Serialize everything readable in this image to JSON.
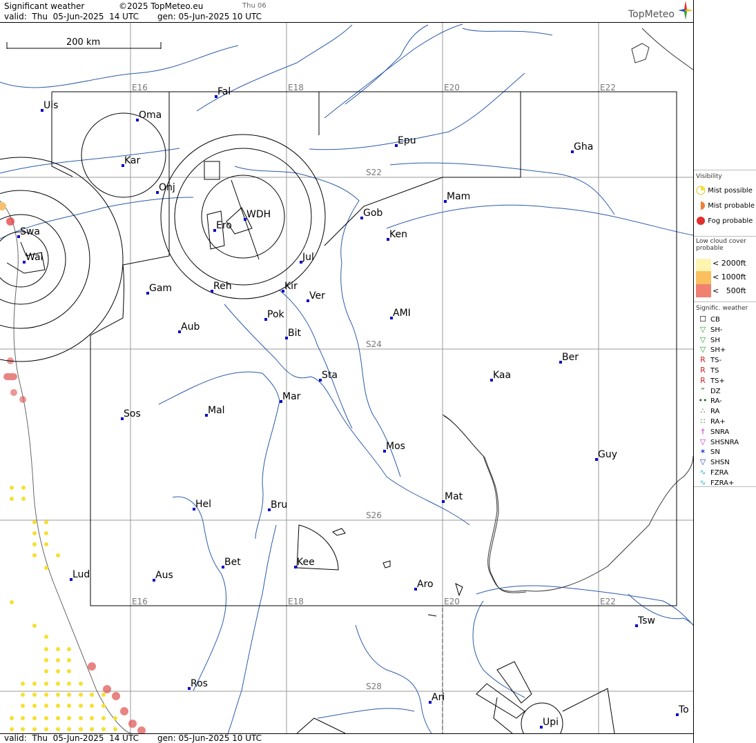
{
  "header": {
    "product": "Significant weather",
    "copyright": "©2025 TopMeteo.eu",
    "day_tag": "Thu 06",
    "valid": "valid:  Thu  05-Jun-2025  14 UTC",
    "generated": "gen: 05-Jun-2025 10 UTC",
    "brand": "TopMeteo"
  },
  "footer": {
    "valid": "valid:  Thu  05-Jun-2025  14 UTC",
    "generated": "gen: 05-Jun-2025 10 UTC"
  },
  "scale_bar": {
    "label": "200 km"
  },
  "grid_labels": {
    "lon_top": [
      "E16",
      "E18",
      "E20",
      "E22"
    ],
    "lon_bottom": [
      "E16",
      "E18",
      "E20",
      "E22"
    ],
    "lat": [
      "S22",
      "S24",
      "S26",
      "S28"
    ]
  },
  "places": [
    {
      "name": "Uis"
    },
    {
      "name": "Fal"
    },
    {
      "name": "Oma"
    },
    {
      "name": "Kar"
    },
    {
      "name": "Epu"
    },
    {
      "name": "Gha"
    },
    {
      "name": "Onj"
    },
    {
      "name": "Mam"
    },
    {
      "name": "Swa"
    },
    {
      "name": "WDH"
    },
    {
      "name": "Gob"
    },
    {
      "name": "Ero"
    },
    {
      "name": "Ken"
    },
    {
      "name": "Wal"
    },
    {
      "name": "Jul"
    },
    {
      "name": "Gam"
    },
    {
      "name": "Reh"
    },
    {
      "name": "Kir"
    },
    {
      "name": "Ver"
    },
    {
      "name": "Pok"
    },
    {
      "name": "AMI"
    },
    {
      "name": "Aub"
    },
    {
      "name": "Bit"
    },
    {
      "name": "Ber"
    },
    {
      "name": "Sta"
    },
    {
      "name": "Kaa"
    },
    {
      "name": "Mar"
    },
    {
      "name": "Sos"
    },
    {
      "name": "Mal"
    },
    {
      "name": "Mos"
    },
    {
      "name": "Guy"
    },
    {
      "name": "Mat"
    },
    {
      "name": "Hel"
    },
    {
      "name": "Bru"
    },
    {
      "name": "Bet"
    },
    {
      "name": "Kee"
    },
    {
      "name": "Lud"
    },
    {
      "name": "Aus"
    },
    {
      "name": "Aro"
    },
    {
      "name": "Tsw"
    },
    {
      "name": "Ros"
    },
    {
      "name": "Ari"
    },
    {
      "name": "To"
    },
    {
      "name": "Upi"
    }
  ],
  "legend": {
    "visibility": {
      "title": "Visibility",
      "items": [
        "Mist possible",
        "Mist probable",
        "Fog probable"
      ],
      "colors": [
        "#f5e030",
        "#f08030",
        "#e03030"
      ]
    },
    "low_cloud": {
      "title": "Low cloud cover probable",
      "items": [
        "< 2000ft",
        "< 1000ft",
        "<   500ft"
      ],
      "colors": [
        "#fff3b0",
        "#fbbf60",
        "#f08070"
      ]
    },
    "sigwx": {
      "title": "Signific. weather",
      "items": [
        {
          "label": "CB",
          "icon": "cb-icon",
          "color": "#000"
        },
        {
          "label": "SH-",
          "icon": "shower-light-icon",
          "color": "#2a9a2a"
        },
        {
          "label": "SH",
          "icon": "shower-icon",
          "color": "#2a9a2a"
        },
        {
          "label": "SH+",
          "icon": "shower-heavy-icon",
          "color": "#2a9a2a"
        },
        {
          "label": "TS-",
          "icon": "thunderstorm-light-icon",
          "color": "#d02020"
        },
        {
          "label": "TS",
          "icon": "thunderstorm-icon",
          "color": "#d02020"
        },
        {
          "label": "TS+",
          "icon": "thunderstorm-heavy-icon",
          "color": "#d02020"
        },
        {
          "label": "DZ",
          "icon": "drizzle-icon",
          "color": "#1a6a1a"
        },
        {
          "label": "RA-",
          "icon": "rain-light-icon",
          "color": "#1a6a1a"
        },
        {
          "label": "RA",
          "icon": "rain-icon",
          "color": "#1a6a1a"
        },
        {
          "label": "RA+",
          "icon": "rain-heavy-icon",
          "color": "#1a6a1a"
        },
        {
          "label": "SNRA",
          "icon": "sleet-icon",
          "color": "#c030c0"
        },
        {
          "label": "SHSNRA",
          "icon": "sleet-shower-icon",
          "color": "#c030c0"
        },
        {
          "label": "SN",
          "icon": "snow-icon",
          "color": "#2040c0"
        },
        {
          "label": "SHSN",
          "icon": "snow-shower-icon",
          "color": "#2040c0"
        },
        {
          "label": "FZRA",
          "icon": "freezing-rain-icon",
          "color": "#30b0d0"
        },
        {
          "label": "FZRA+",
          "icon": "freezing-rain-heavy-icon",
          "color": "#30b0d0"
        }
      ]
    }
  },
  "colors": {
    "river": "#2a5aa8",
    "grid": "#888888",
    "place_dot": "#0000cc",
    "airspace": "#000000"
  }
}
